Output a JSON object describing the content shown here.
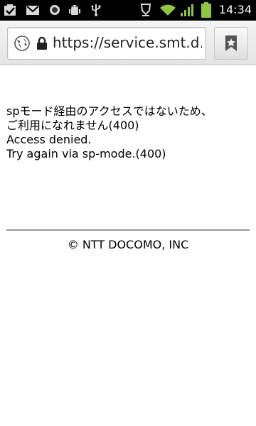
{
  "status_bar": {
    "time": "14:34",
    "icons": [
      "tasks-icon",
      "gmail-icon",
      "voicemail-icon",
      "android-debug-icon",
      "usb-icon",
      "alarm-icon",
      "wifi-icon",
      "signal-icon",
      "battery-icon"
    ],
    "colors": {
      "background": "#000000",
      "wifi": "#8ec63f",
      "signal": "#8ec63f",
      "battery": "#8ec63f"
    }
  },
  "browser": {
    "url": "https://service.smt.d…",
    "icons": [
      "site-globe-icon",
      "lock-icon",
      "bookmark-icon"
    ]
  },
  "page": {
    "message_lines": [
      "spモード経由のアクセスではないため、",
      "ご利用になれません(400)",
      "Access denied.",
      "Try again via sp-mode.(400)"
    ],
    "footer": "© NTT DOCOMO, INC"
  }
}
